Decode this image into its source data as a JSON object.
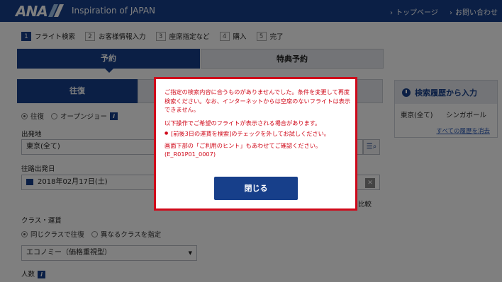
{
  "header": {
    "logo": "ANA",
    "tagline": "Inspiration of JAPAN",
    "links": [
      "トップページ",
      "お問い合わせ"
    ]
  },
  "steps": [
    {
      "num": "1",
      "label": "フライト検索",
      "active": true
    },
    {
      "num": "2",
      "label": "お客様情報入力",
      "active": false
    },
    {
      "num": "3",
      "label": "座席指定など",
      "active": false
    },
    {
      "num": "4",
      "label": "購入",
      "active": false
    },
    {
      "num": "5",
      "label": "完了",
      "active": false
    }
  ],
  "tabs": {
    "reserve": "予約",
    "award": "特典予約"
  },
  "trip_tabs": {
    "round": "往復"
  },
  "trip_type": {
    "round": "往復",
    "open_jaw": "オープンジョー",
    "selected": "round"
  },
  "origin": {
    "label": "出発地",
    "value": "東京(全て)"
  },
  "depart_date": {
    "label": "往路出発日",
    "value": "2018年02月17日(土)"
  },
  "compare_label": "比較",
  "class": {
    "label": "クラス・運賃",
    "same": "同じクラスで往復",
    "different": "異なるクラスを指定",
    "selected": "same",
    "value": "エコノミー（価格重視型）"
  },
  "passengers_label": "人数",
  "history": {
    "title": "検索履歴から入力",
    "from": "東京(全て)",
    "to": "シンガポール",
    "link": "すべての履歴を消去"
  },
  "dialog": {
    "line1": "ご指定の検索内容に合うものがありませんでした。条件を変更して再度検索ください。なお、インターネットからは空席のないフライトは表示できません。",
    "line2": "以下操作でご希望のフライトが表示される場合があります。",
    "bullet": "[前後3日の運賃を検索]のチェックを外してお試しください。",
    "line3": "画面下部の「ご利用のヒント」もあわせてご確認ください。(E_R01P01_0007)",
    "close": "閉じる"
  },
  "colors": {
    "brand": "#173f8a",
    "error": "#d0091a"
  }
}
